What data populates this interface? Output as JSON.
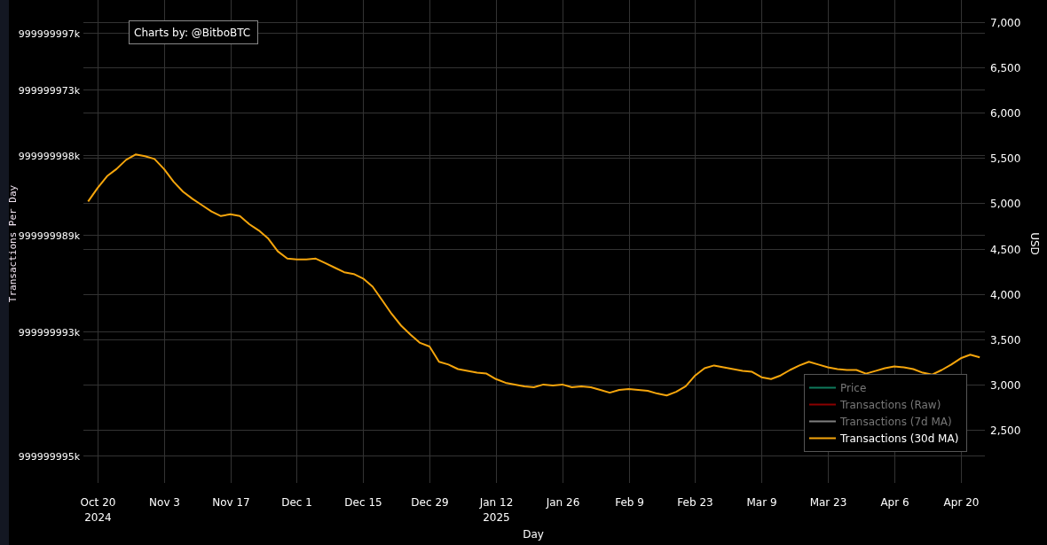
{
  "credit": {
    "text": "Charts by: @BitboBTC"
  },
  "left_axis": {
    "title": "Transactions Per Day",
    "tick_labels": [
      "999999997k",
      "999999973k",
      "999999998k",
      "999999989k",
      "999999993k",
      "999999995k"
    ]
  },
  "chart_data": {
    "type": "line",
    "xlabel": "Day",
    "ylabel": "USD",
    "grid": true,
    "ylim": [
      1913,
      7245
    ],
    "yticks": [
      {
        "value": 7000,
        "label": "7,000"
      },
      {
        "value": 6500,
        "label": "6,500"
      },
      {
        "value": 6000,
        "label": "6,000"
      },
      {
        "value": 5500,
        "label": "5,500"
      },
      {
        "value": 5000,
        "label": "5,000"
      },
      {
        "value": 4500,
        "label": "4,500"
      },
      {
        "value": 4000,
        "label": "4,000"
      },
      {
        "value": 3500,
        "label": "3,500"
      },
      {
        "value": 3000,
        "label": "3,000"
      },
      {
        "value": 2500,
        "label": "2,500"
      }
    ],
    "categories": [
      null,
      "Oct 20\n2024",
      null,
      null,
      null,
      null,
      null,
      null,
      "Nov 3",
      null,
      null,
      null,
      null,
      null,
      null,
      "Nov 17",
      null,
      null,
      null,
      null,
      null,
      null,
      "Dec 1",
      null,
      null,
      null,
      null,
      null,
      null,
      "Dec 15",
      null,
      null,
      null,
      null,
      null,
      null,
      "Dec 29",
      null,
      null,
      null,
      null,
      null,
      null,
      "Jan 12\n2025",
      null,
      null,
      null,
      null,
      null,
      null,
      "Jan 26",
      null,
      null,
      null,
      null,
      null,
      null,
      "Feb 9",
      null,
      null,
      null,
      null,
      null,
      null,
      "Feb 23",
      null,
      null,
      null,
      null,
      null,
      null,
      "Mar 9",
      null,
      null,
      null,
      null,
      null,
      null,
      "Mar 23",
      null,
      null,
      null,
      null,
      null,
      null,
      "Apr 6",
      null,
      null,
      null,
      null,
      null,
      null,
      "Apr 20",
      null,
      null
    ],
    "series": [
      {
        "name": "Price",
        "color": "#0f7a5c",
        "values": [
          null,
          null,
          null,
          null,
          null,
          null,
          null,
          null,
          null,
          null,
          null,
          null,
          null,
          null,
          null,
          null,
          null,
          null,
          null,
          null,
          null,
          null,
          null,
          null,
          null,
          null,
          null,
          null,
          null,
          null,
          null,
          null,
          null,
          null,
          null,
          null,
          null,
          null,
          null,
          null,
          null,
          null,
          null,
          null,
          null,
          null,
          null,
          null,
          null,
          null,
          null,
          null,
          null,
          null,
          null,
          null,
          null,
          null,
          null,
          null,
          null,
          null,
          null,
          null,
          null,
          null,
          null,
          null,
          null,
          null,
          null,
          null,
          null,
          null,
          null,
          null,
          null,
          null,
          null,
          null,
          null,
          null,
          null,
          null,
          null,
          null,
          null,
          null,
          null,
          null,
          null,
          null,
          null,
          null,
          null
        ]
      },
      {
        "name": "Transactions (Raw)",
        "color": "#8b0000",
        "values": [
          null,
          null,
          null,
          null,
          null,
          null,
          null,
          null,
          null,
          null,
          null,
          null,
          null,
          null,
          null,
          null,
          null,
          null,
          null,
          null,
          null,
          null,
          null,
          null,
          null,
          null,
          null,
          null,
          null,
          null,
          null,
          null,
          null,
          null,
          null,
          null,
          null,
          null,
          null,
          null,
          null,
          null,
          null,
          null,
          null,
          null,
          null,
          null,
          null,
          null,
          null,
          null,
          null,
          null,
          null,
          null,
          null,
          null,
          null,
          null,
          null,
          null,
          null,
          null,
          null,
          null,
          null,
          null,
          null,
          null,
          null,
          null,
          null,
          null,
          null,
          null,
          null,
          null,
          null,
          null,
          null,
          null,
          null,
          null,
          null,
          null,
          null,
          null,
          null,
          null,
          null,
          null,
          null,
          null,
          null
        ]
      },
      {
        "name": "Transactions (7d MA)",
        "color": "#808080",
        "values": [
          null,
          null,
          null,
          null,
          null,
          null,
          null,
          null,
          null,
          null,
          null,
          null,
          null,
          null,
          null,
          null,
          null,
          null,
          null,
          null,
          null,
          null,
          null,
          null,
          null,
          null,
          null,
          null,
          null,
          null,
          null,
          null,
          null,
          null,
          null,
          null,
          null,
          null,
          null,
          null,
          null,
          null,
          null,
          null,
          null,
          null,
          null,
          null,
          null,
          null,
          null,
          null,
          null,
          null,
          null,
          null,
          null,
          null,
          null,
          null,
          null,
          null,
          null,
          null,
          null,
          null,
          null,
          null,
          null,
          null,
          null,
          null,
          null,
          null,
          null,
          null,
          null,
          null,
          null,
          null,
          null,
          null,
          null,
          null,
          null,
          null,
          null,
          null,
          null,
          null,
          null,
          null,
          null,
          null,
          null
        ]
      },
      {
        "name": "Transactions (30d MA)",
        "color": "#f5a50c",
        "values": [
          5020,
          5170,
          5300,
          5380,
          5480,
          5540,
          5520,
          5490,
          5380,
          5240,
          5130,
          5050,
          4980,
          4910,
          4860,
          4880,
          4860,
          4770,
          4700,
          4610,
          4470,
          4390,
          4380,
          4380,
          4390,
          4340,
          4290,
          4240,
          4220,
          4170,
          4080,
          3930,
          3780,
          3650,
          3550,
          3460,
          3420,
          3250,
          3220,
          3170,
          3150,
          3130,
          3120,
          3060,
          3020,
          3000,
          2980,
          2970,
          3000,
          2990,
          3000,
          2970,
          2980,
          2970,
          2940,
          2910,
          2940,
          2950,
          2940,
          2930,
          2900,
          2880,
          2920,
          2980,
          3100,
          3180,
          3210,
          3190,
          3170,
          3150,
          3140,
          3080,
          3060,
          3100,
          3160,
          3210,
          3250,
          3220,
          3190,
          3170,
          3160,
          3160,
          3120,
          3150,
          3180,
          3200,
          3190,
          3170,
          3130,
          3110,
          3160,
          3220,
          3290,
          3330,
          3300
        ]
      }
    ]
  }
}
